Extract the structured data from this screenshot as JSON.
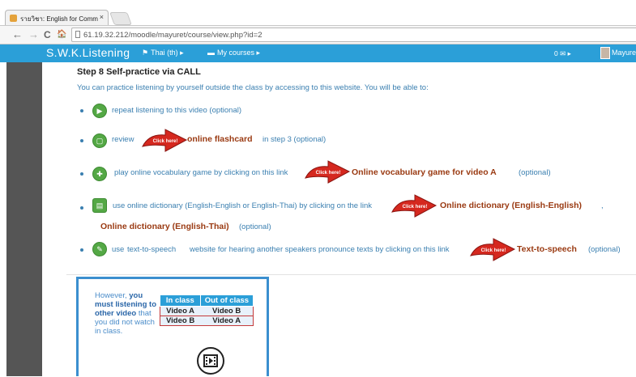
{
  "browser": {
    "tab_title": "รายวิชา: English for Comm",
    "tab_close": "×",
    "url": "61.19.32.212/moodle/mayuret/course/view.php?id=2",
    "back": "←",
    "forward": "→",
    "reload": "C",
    "home": "🏠"
  },
  "navbar": {
    "brand": "S.W.K.Listening",
    "language": "Thai (th) ▸",
    "my_courses": "My courses ▸",
    "messages": "0 ✉ ▸",
    "user": "Mayuret"
  },
  "content": {
    "heading": "Step 8 Self-practice via CALL",
    "intro": "You can practice listening by yourself outside the class by accessing to this website. You will be able to:",
    "click_here": "Click here!",
    "items": [
      {
        "pre": "repeat listening to this video (optional)",
        "icon": "video-icon"
      },
      {
        "pre": "review",
        "link": "online flashcard",
        "post": "in step 3 (optional)",
        "icon": "flashcard-icon"
      },
      {
        "pre": "play online vocabulary game by clicking on this link",
        "link": "Online vocabulary game for video A",
        "post": "(optional)",
        "icon": "gamepad-icon"
      },
      {
        "pre": "use online dictionary (English-English or English-Thai) by clicking on the link",
        "link": "Online dictionary (English-English)",
        "sep": ",",
        "link2": "Online dictionary (English-Thai)",
        "post": "(optional)",
        "icon": "dictionary-icon"
      },
      {
        "pre": "use",
        "pre_link": "text-to-speech",
        "mid": "website for hearing another speakers pronounce texts by clicking on this link",
        "link": "Text-to-speech",
        "post": "(optional)",
        "icon": "speech-icon"
      }
    ]
  },
  "infobox": {
    "t1": "However,",
    "t2": "you must listening to other video",
    "t3": "that you did not watch in class.",
    "headers": [
      "In class",
      "Out of class"
    ],
    "rows": [
      [
        "Video A",
        "Video B"
      ],
      [
        "Video B",
        "Video A"
      ]
    ]
  },
  "colors": {
    "navbar": "#2b9fd8",
    "link_blue": "#3a7fb0",
    "link_brown": "#9a3a12",
    "icon_green": "#54a845"
  }
}
